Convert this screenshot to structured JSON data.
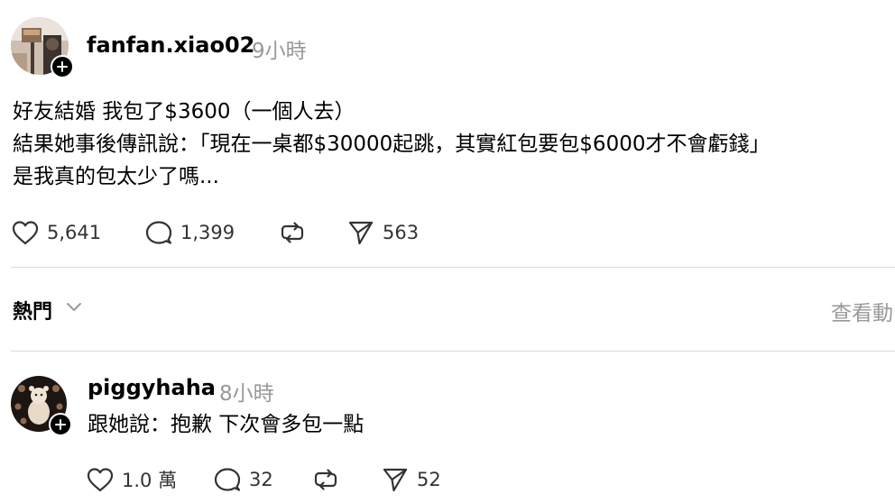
{
  "post": {
    "username": "fanfan.xiao02",
    "time": "9小時",
    "lines": [
      "好友結婚 我包了$3600（一個人去）",
      "結果她事後傳訊說：「現在一桌都$30000起跳，其實紅包要包$6000才不會虧錢」",
      "是我真的包太少了嗎..."
    ],
    "likes": "5,641",
    "comments": "1,399",
    "shares": "563"
  },
  "sort": {
    "label": "熱門",
    "view_activity": "查看動"
  },
  "reply": {
    "username": "piggyhaha",
    "time": "8小時",
    "text": "跟她說：抱歉 下次會多包一點",
    "likes": "1.0 萬",
    "comments": "32",
    "shares": "52"
  },
  "icons": {
    "like": "heart-icon",
    "comment": "comment-bubble-icon",
    "repost": "repost-icon",
    "share": "send-icon",
    "follow": "plus-icon",
    "sort": "chevron-down-icon"
  }
}
